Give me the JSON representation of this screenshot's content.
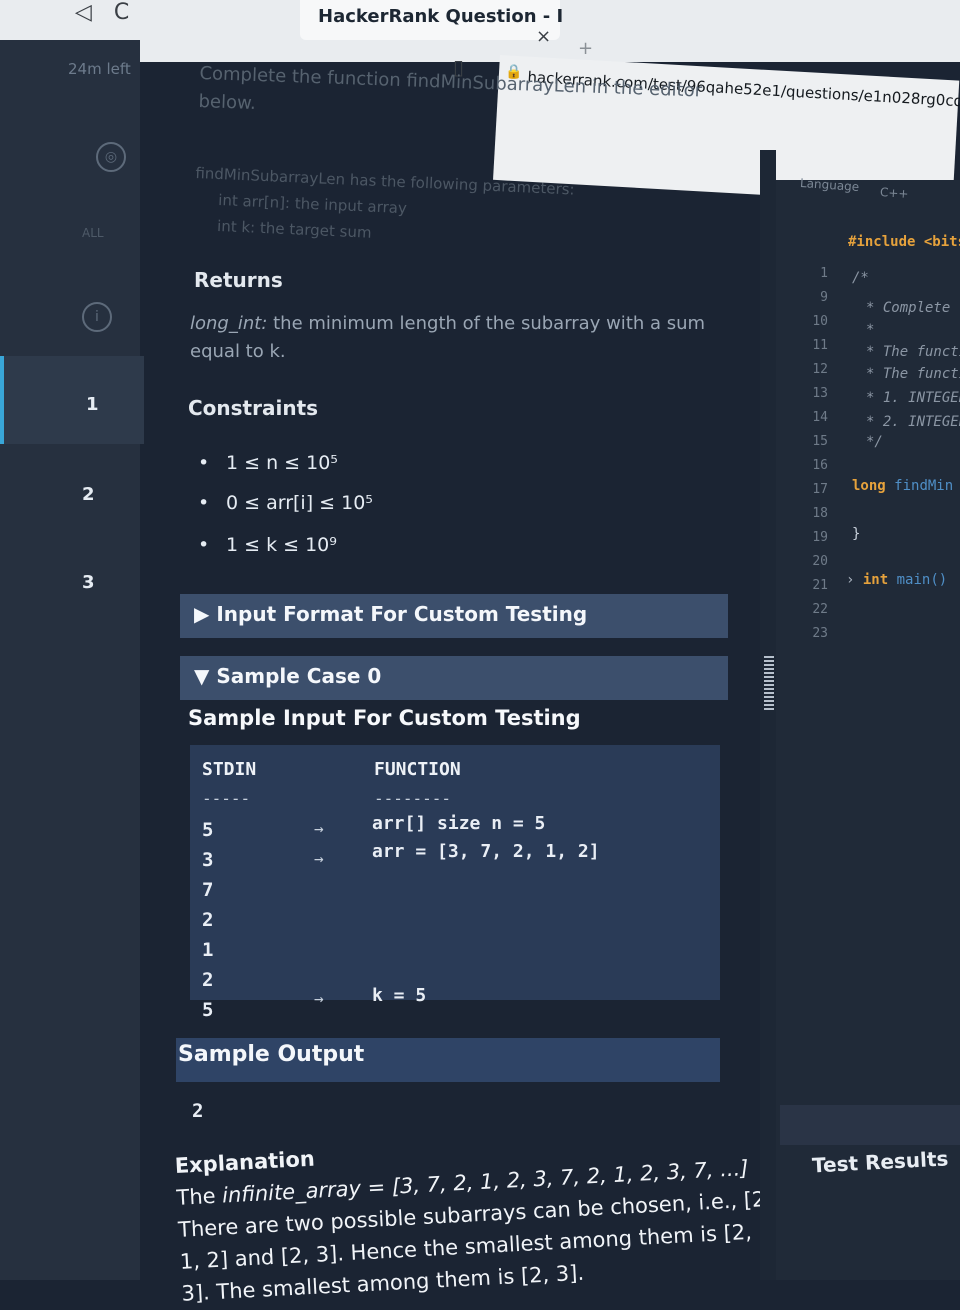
{
  "browser": {
    "tab_title": "HackerRank Question - I",
    "close": "×",
    "url": "hackerrank.com/test/96qahe52e1/questions/e1n028rg0cd"
  },
  "sidebar": {
    "timer": "24m left",
    "all_label": "ALL",
    "questions": [
      "1",
      "2",
      "3"
    ],
    "active_question": "1"
  },
  "problem": {
    "intro": "Complete the function findMinSubarrayLen in the editor below.",
    "params_line": "findMinSubarrayLen has the following parameters:",
    "param1": "int arr[n]: the input array",
    "param2": "int k: the target sum",
    "returns_heading": "Returns",
    "returns_type": "long_int:",
    "returns_text": "the minimum length of the subarray with a sum equal to k.",
    "constraints_heading": "Constraints",
    "constraints": [
      "1 ≤ n ≤ 10⁵",
      "0 ≤ arr[i] ≤ 10⁵",
      "1 ≤ k ≤ 10⁹"
    ],
    "input_format_label": "Input Format For Custom Testing",
    "sample_case_label": "Sample Case 0",
    "sample_input_heading": "Sample Input For Custom Testing",
    "stdin_header": "STDIN",
    "function_header": "FUNCTION",
    "stdin_dash": "-----",
    "function_dash": "--------",
    "stdin_values": [
      "5",
      "3",
      "7",
      "2",
      "1",
      "2",
      "5"
    ],
    "arrow": "→",
    "fn_line1": "arr[] size n = 5",
    "fn_line2": "arr = [3, 7, 2, 1, 2]",
    "fn_line3": "k = 5",
    "sample_output_heading": "Sample Output",
    "sample_output_value": "2",
    "explanation_heading": "Explanation",
    "explanation_p1": "The ",
    "explanation_array": "infinite_array = [3, 7, 2, 1, 2, 3, 7, 2, 1, 2, 3, 7, ...]",
    "explanation_p2": " There are two possible subarrays can be chosen, i.e., [2, 1, 2] and [2, 3]. Hence the smallest among them is [2, 3]. The smallest among them is [2, 3]."
  },
  "editor": {
    "language_label": "Language",
    "language_value": "C++",
    "line_numbers": [
      "1",
      "9",
      "10",
      "11",
      "12",
      "13",
      "14",
      "15",
      "16",
      "17",
      "18",
      "19",
      "20",
      "21",
      "22",
      "23"
    ],
    "code_include": "#include <bits",
    "code_comment_open": "/*",
    "code_complete": "* Complete t",
    "code_star": "*",
    "code_funct1": "* The functi",
    "code_funct2": "* The functi",
    "code_param1": "*  1. INTEGER",
    "code_param2": "*  2. INTEGER",
    "code_comment_close": "*/",
    "code_long": "long",
    "code_fname": "findMin",
    "code_brace": "}",
    "code_int": "int",
    "code_main": "main()",
    "test_results": "Test Results"
  }
}
